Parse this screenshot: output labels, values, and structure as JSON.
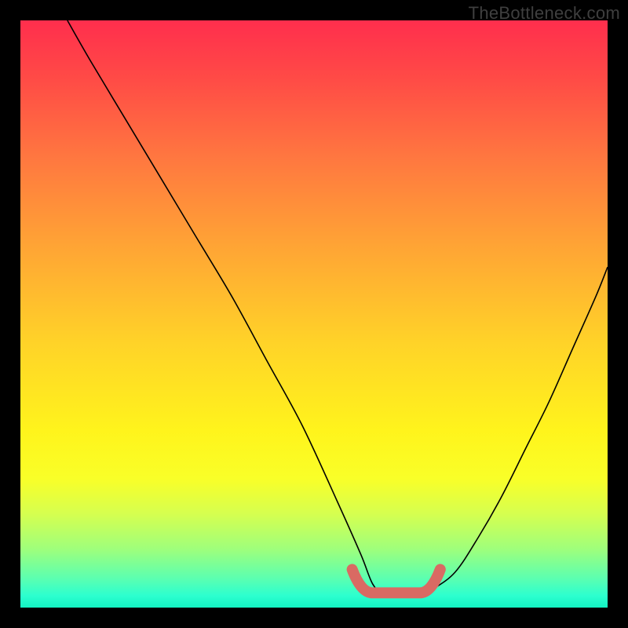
{
  "watermark": "TheBottleneck.com",
  "colors": {
    "background": "#000000",
    "curve": "#000000",
    "highlight": "#d96a63",
    "gradient_top": "#ff2e4d",
    "gradient_bottom": "#13f3c2"
  },
  "chart_data": {
    "type": "line",
    "title": "",
    "xlabel": "",
    "ylabel": "",
    "xlim": [
      0,
      100
    ],
    "ylim": [
      0,
      100
    ],
    "grid": false,
    "legend": false,
    "series": [
      {
        "name": "bottleneck-curve",
        "x": [
          8,
          12,
          18,
          24,
          30,
          36,
          42,
          48,
          54,
          58,
          60,
          62,
          64,
          66,
          68,
          70,
          74,
          78,
          82,
          86,
          90,
          94,
          98,
          100
        ],
        "y": [
          100,
          93,
          83,
          73,
          63,
          53,
          42,
          31,
          18,
          9,
          4,
          2,
          2,
          2,
          2,
          3,
          6,
          12,
          19,
          27,
          35,
          44,
          53,
          58
        ]
      }
    ],
    "annotations": [
      {
        "name": "optimal-segment",
        "type": "highlight",
        "x_range": [
          58,
          70
        ],
        "y": 2.5
      }
    ]
  }
}
